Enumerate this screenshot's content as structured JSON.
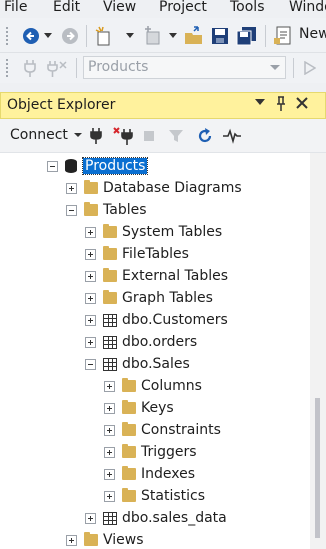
{
  "menu": [
    "File",
    "Edit",
    "View",
    "Project",
    "Tools",
    "Windo"
  ],
  "toolbar": {
    "new_query_label": "New",
    "database_select": "Products"
  },
  "object_explorer": {
    "title": "Object Explorer",
    "pin_glyph": "▾",
    "pushpin_glyph": "📌",
    "close_glyph": "✕",
    "connect_label": "Connect"
  },
  "tree": [
    {
      "label": "Products",
      "kind": "database",
      "state": "expanded",
      "selected": true
    },
    {
      "label": "Database Diagrams",
      "kind": "folder",
      "state": "collapsed"
    },
    {
      "label": "Tables",
      "kind": "folder",
      "state": "expanded"
    },
    {
      "label": "System Tables",
      "kind": "folder",
      "state": "collapsed"
    },
    {
      "label": "FileTables",
      "kind": "folder",
      "state": "collapsed"
    },
    {
      "label": "External Tables",
      "kind": "folder",
      "state": "collapsed"
    },
    {
      "label": "Graph Tables",
      "kind": "folder",
      "state": "collapsed"
    },
    {
      "label": "dbo.Customers",
      "kind": "table",
      "state": "collapsed"
    },
    {
      "label": "dbo.orders",
      "kind": "table",
      "state": "collapsed"
    },
    {
      "label": "dbo.Sales",
      "kind": "table",
      "state": "expanded"
    },
    {
      "label": "Columns",
      "kind": "folder",
      "state": "collapsed"
    },
    {
      "label": "Keys",
      "kind": "folder",
      "state": "collapsed"
    },
    {
      "label": "Constraints",
      "kind": "folder",
      "state": "collapsed"
    },
    {
      "label": "Triggers",
      "kind": "folder",
      "state": "collapsed"
    },
    {
      "label": "Indexes",
      "kind": "folder",
      "state": "collapsed"
    },
    {
      "label": "Statistics",
      "kind": "folder",
      "state": "collapsed"
    },
    {
      "label": "dbo.sales_data",
      "kind": "table",
      "state": "collapsed"
    },
    {
      "label": "Views",
      "kind": "folder",
      "state": "collapsed"
    }
  ],
  "colors": {
    "title_bar": "#fff29d",
    "selection": "#0a6fd1",
    "folder": "#d9b256"
  }
}
